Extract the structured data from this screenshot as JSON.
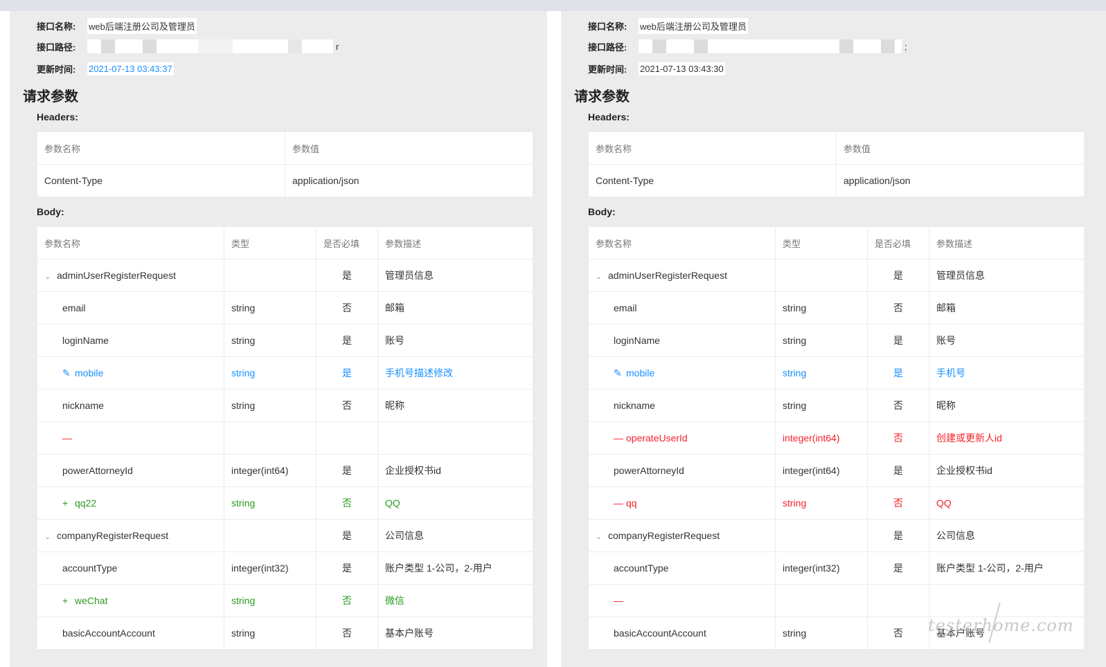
{
  "meta_labels": {
    "name": "接口名称:",
    "path": "接口路径:",
    "updated": "更新时间:"
  },
  "section_title": "请求参数",
  "headers_title": "Headers:",
  "body_title": "Body:",
  "headers_table": {
    "columns": [
      "参数名称",
      "参数值"
    ],
    "row": {
      "name": "Content-Type",
      "value": "application/json"
    }
  },
  "body_columns": [
    "参数名称",
    "类型",
    "是否必填",
    "参数描述"
  ],
  "left": {
    "api_name": "web后端注册公司及管理员",
    "path_tail": "r",
    "updated": "2021-07-13 03:43:37",
    "rows": [
      {
        "name": "adminUserRegisterRequest",
        "type": "",
        "required": "是",
        "desc": "管理员信息",
        "level": 0,
        "caret": "⌄",
        "mark": "",
        "status": "normal"
      },
      {
        "name": "email",
        "type": "string",
        "required": "否",
        "desc": "邮箱",
        "level": 1,
        "caret": "",
        "mark": "",
        "status": "normal"
      },
      {
        "name": "loginName",
        "type": "string",
        "required": "是",
        "desc": "账号",
        "level": 1,
        "caret": "",
        "mark": "",
        "status": "normal"
      },
      {
        "name": "mobile",
        "type": "string",
        "required": "是",
        "desc": "手机号描述修改",
        "level": 1,
        "caret": "",
        "mark": "✎",
        "status": "blue"
      },
      {
        "name": "nickname",
        "type": "string",
        "required": "否",
        "desc": "昵称",
        "level": 1,
        "caret": "",
        "mark": "",
        "status": "normal"
      },
      {
        "name": "",
        "type": "",
        "required": "",
        "desc": "",
        "level": 1,
        "caret": "",
        "mark": "—",
        "status": "red"
      },
      {
        "name": "powerAttorneyId",
        "type": "integer(int64)",
        "required": "是",
        "desc": "企业授权书id",
        "level": 1,
        "caret": "",
        "mark": "",
        "status": "normal"
      },
      {
        "name": "qq22",
        "type": "string",
        "required": "否",
        "desc": "QQ",
        "level": 1,
        "caret": "",
        "mark": "+",
        "status": "green"
      },
      {
        "name": "companyRegisterRequest",
        "type": "",
        "required": "是",
        "desc": "公司信息",
        "level": 0,
        "caret": "⌄",
        "mark": "",
        "status": "normal"
      },
      {
        "name": "accountType",
        "type": "integer(int32)",
        "required": "是",
        "desc": "账户类型 1-公司，2-用户",
        "level": 1,
        "caret": "",
        "mark": "",
        "status": "normal"
      },
      {
        "name": "weChat",
        "type": "string",
        "required": "否",
        "desc": "微信",
        "level": 1,
        "caret": "",
        "mark": "+",
        "status": "green"
      },
      {
        "name": "basicAccountAccount",
        "type": "string",
        "required": "否",
        "desc": "基本户账号",
        "level": 1,
        "caret": "",
        "mark": "",
        "status": "normal"
      }
    ]
  },
  "right": {
    "api_name": "web后端注册公司及管理员",
    "path_tail": ";",
    "updated": "2021-07-13 03:43:30",
    "rows": [
      {
        "name": "adminUserRegisterRequest",
        "type": "",
        "required": "是",
        "desc": "管理员信息",
        "level": 0,
        "caret": "⌄",
        "mark": "",
        "status": "normal"
      },
      {
        "name": "email",
        "type": "string",
        "required": "否",
        "desc": "邮箱",
        "level": 1,
        "caret": "",
        "mark": "",
        "status": "normal"
      },
      {
        "name": "loginName",
        "type": "string",
        "required": "是",
        "desc": "账号",
        "level": 1,
        "caret": "",
        "mark": "",
        "status": "normal"
      },
      {
        "name": "mobile",
        "type": "string",
        "required": "是",
        "desc": "手机号",
        "level": 1,
        "caret": "",
        "mark": "✎",
        "status": "blue"
      },
      {
        "name": "nickname",
        "type": "string",
        "required": "否",
        "desc": "昵称",
        "level": 1,
        "caret": "",
        "mark": "",
        "status": "normal"
      },
      {
        "name": "operateUserId",
        "type": "integer(int64)",
        "required": "否",
        "desc": "创建或更新人id",
        "level": 1,
        "caret": "",
        "mark": "—",
        "status": "red"
      },
      {
        "name": "powerAttorneyId",
        "type": "integer(int64)",
        "required": "是",
        "desc": "企业授权书id",
        "level": 1,
        "caret": "",
        "mark": "",
        "status": "normal"
      },
      {
        "name": "qq",
        "type": "string",
        "required": "否",
        "desc": "QQ",
        "level": 1,
        "caret": "",
        "mark": "—",
        "status": "red"
      },
      {
        "name": "companyRegisterRequest",
        "type": "",
        "required": "是",
        "desc": "公司信息",
        "level": 0,
        "caret": "⌄",
        "mark": "",
        "status": "normal"
      },
      {
        "name": "accountType",
        "type": "integer(int32)",
        "required": "是",
        "desc": "账户类型 1-公司，2-用户",
        "level": 1,
        "caret": "",
        "mark": "",
        "status": "normal"
      },
      {
        "name": "",
        "type": "",
        "required": "",
        "desc": "",
        "level": 1,
        "caret": "",
        "mark": "—",
        "status": "red"
      },
      {
        "name": "basicAccountAccount",
        "type": "string",
        "required": "否",
        "desc": "基本户账号",
        "level": 1,
        "caret": "",
        "mark": "",
        "status": "normal"
      }
    ]
  },
  "watermark": "testerhome.com",
  "colors": {
    "link": "#1890ff",
    "added": "#2a9b1f",
    "removed": "#f5222d",
    "panel": "#ececec"
  }
}
